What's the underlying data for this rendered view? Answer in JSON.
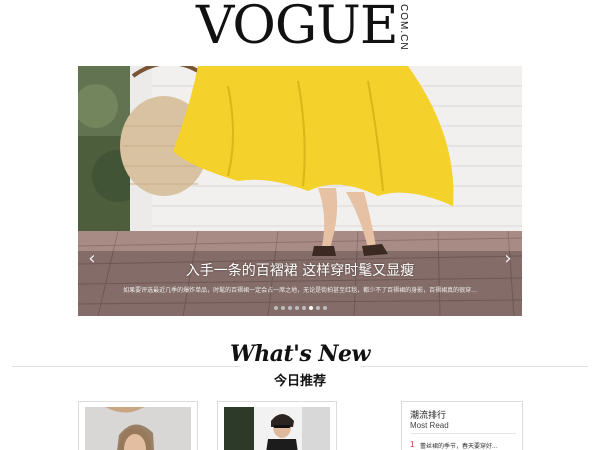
{
  "header": {
    "logo": "VOGUE",
    "logo_side": "COM.CN"
  },
  "carousel": {
    "title": "入手一条的百褶裙 这样穿时髦又显瘦",
    "subtitle": "如果要评选最近几季的爆炸单品，时髦的百褶裙一定会占一席之地，无论是街拍甚至红毯，都少不了百褶裙的身影，百褶裙真的很穿...",
    "prev_icon": "‹",
    "next_icon": "›",
    "dots": [
      false,
      false,
      false,
      false,
      false,
      true,
      false,
      false
    ],
    "colors": {
      "skirt": "#f4d12b",
      "wall": "#f1f0ee",
      "pavement": "#a98b86"
    }
  },
  "whats_new": {
    "title": "What's New",
    "subtitle": "今日推荐"
  },
  "sidebar": {
    "title": "潮流排行",
    "title_en": "Most Read",
    "items": [
      {
        "rank": "1",
        "text": "蕾丝裙的季节，春天要穿好..."
      }
    ]
  }
}
